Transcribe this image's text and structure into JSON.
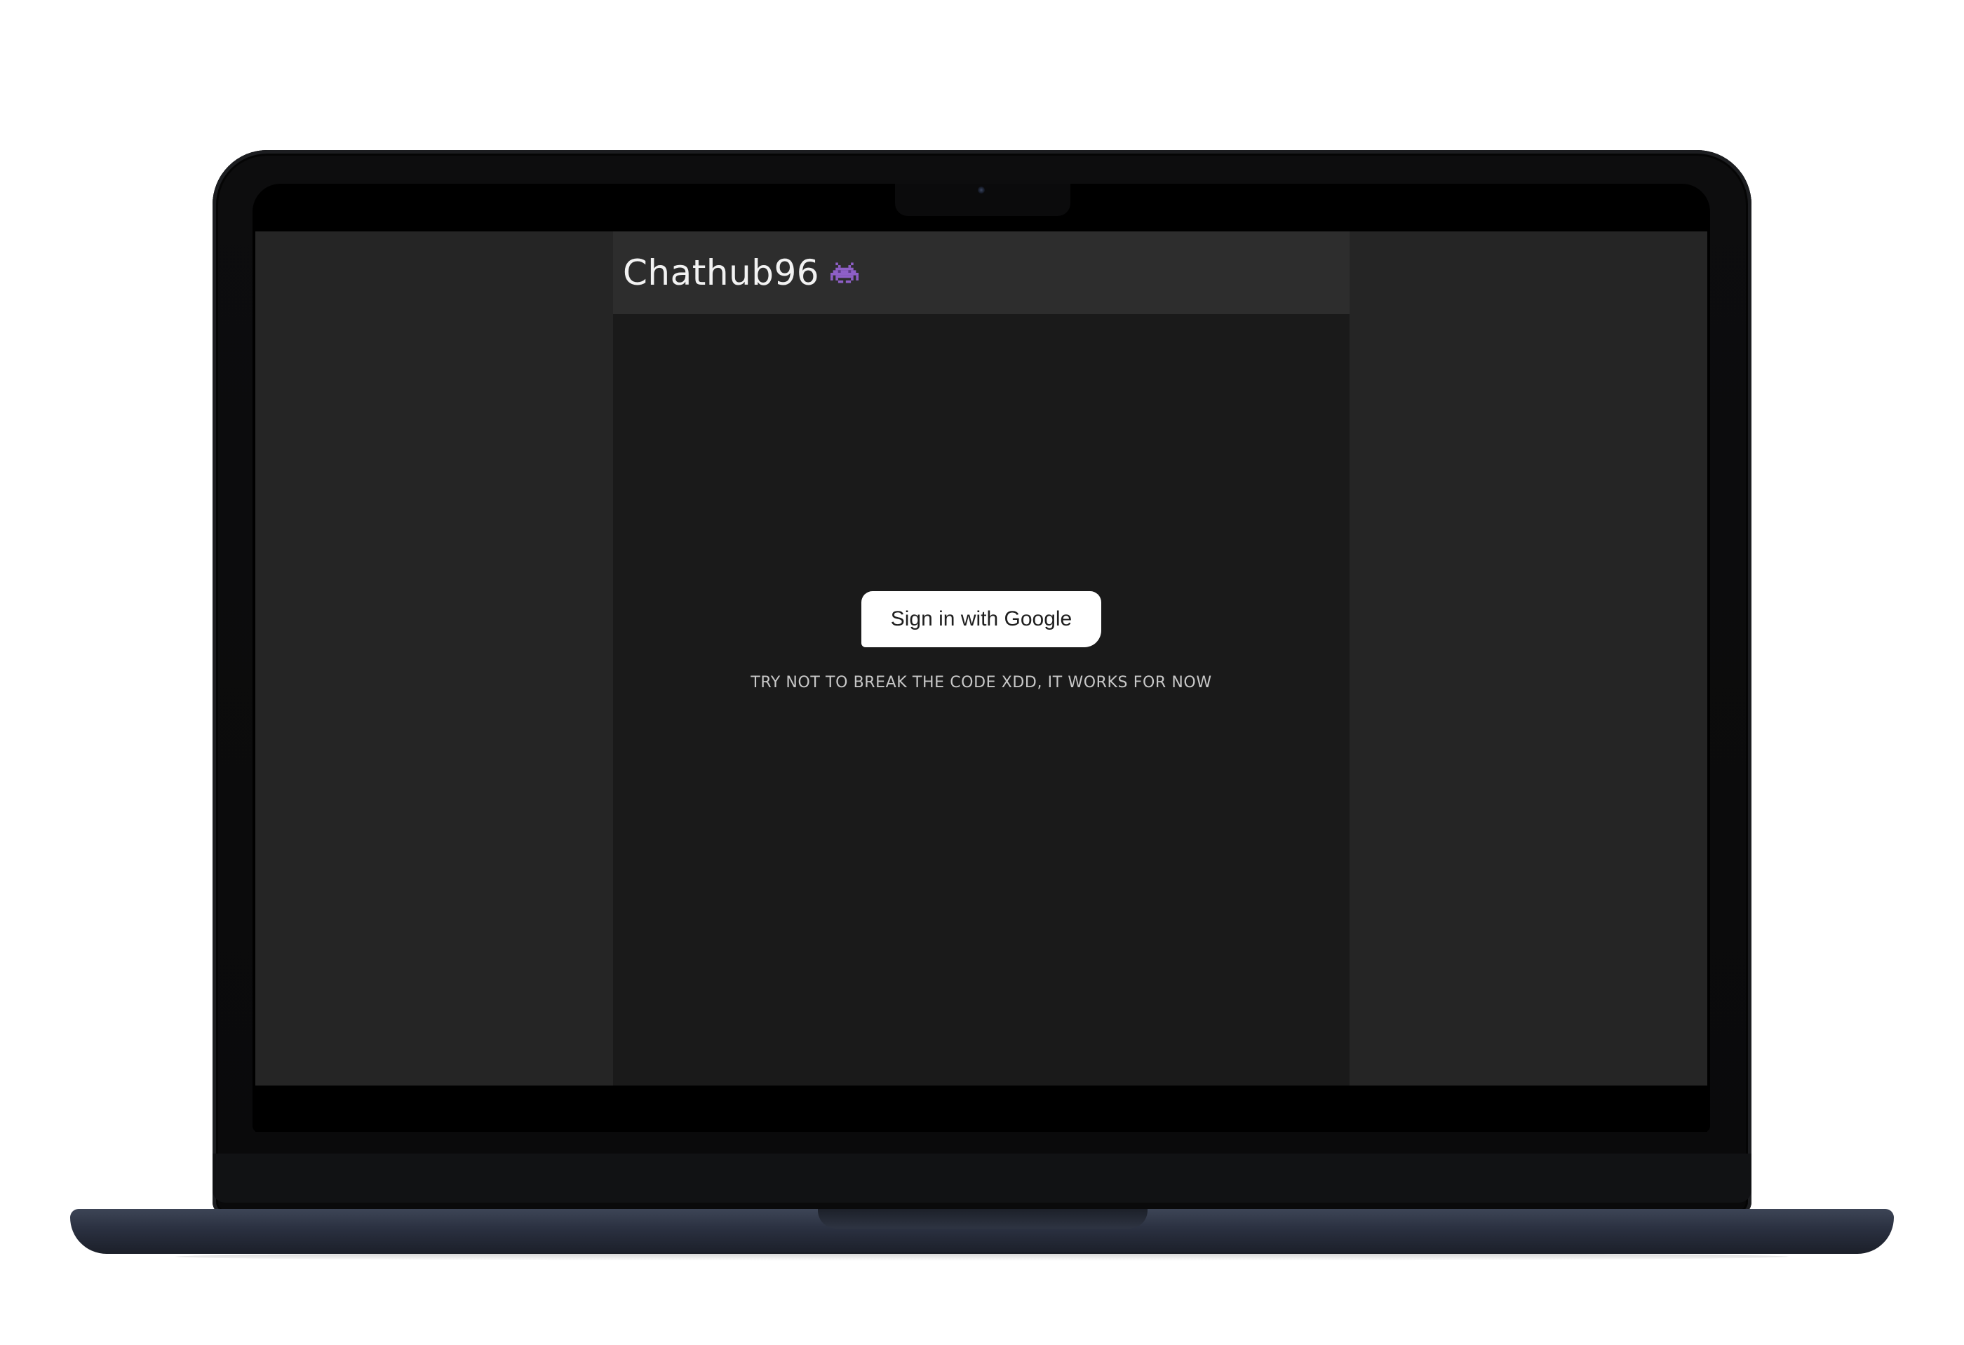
{
  "app": {
    "title": "Chathub96",
    "logo_icon": "alien-monster-icon"
  },
  "auth": {
    "google_button_label": "Sign in with Google",
    "note": "TRY NOT TO BREAK THE CODE XDD, IT WORKS FOR NOW"
  },
  "colors": {
    "page_background": "#ffffff",
    "sidebar_background": "#252525",
    "main_background": "#1a1a1a",
    "header_background": "#2d2d2d",
    "button_background": "#ffffff",
    "icon_purple": "#8e5fc7"
  }
}
